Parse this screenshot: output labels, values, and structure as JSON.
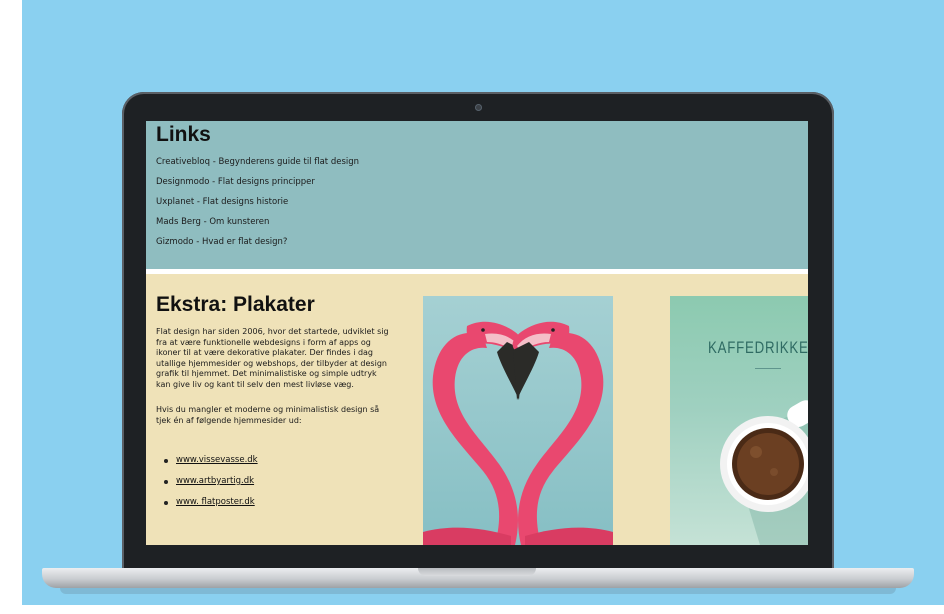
{
  "links_section": {
    "title": "Links",
    "items": [
      "Creativebloq - Begynderens guide til flat design",
      "Designmodo - Flat designs principper",
      "Uxplanet - Flat designs historie",
      "Mads Berg - Om kunsteren",
      "Gizmodo - Hvad er flat design?"
    ]
  },
  "extra_section": {
    "title": "Ekstra: Plakater",
    "paragraph_1": "Flat design har siden 2006, hvor det startede, udviklet sig fra at være funktionelle webdesigns i form af apps og ikoner til at være dekorative plakater. Der findes i dag utallige hjemmesider og webshops, der tilbyder at design grafik til hjemmet. Det minimalistiske og simple udtryk kan give liv og kant til selv den mest livløse væg.",
    "paragraph_2": "Hvis du mangler et moderne og minimalistisk design så tjek én af følgende hjemmesider ud:",
    "sites": [
      "www.vissevasse.dk",
      "www.artbyartig.dk",
      "www. flatposter.dk"
    ]
  },
  "posters": {
    "coffee_title": "KAFFEDRIKKER"
  },
  "colors": {
    "background": "#8ad0f0",
    "links_bg": "#8fbdc0",
    "extra_bg": "#efe2b8",
    "flamingo": "#e9486f"
  }
}
